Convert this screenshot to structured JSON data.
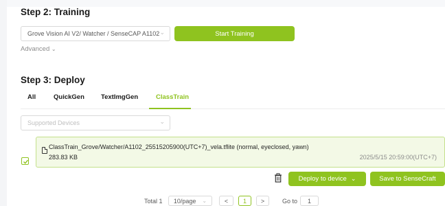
{
  "step2": {
    "title": "Step 2: Training",
    "device_select": "Grove Vision AI V2/ Watcher / SenseCAP A1102",
    "start_button": "Start Training",
    "advanced": "Advanced"
  },
  "step3": {
    "title": "Step 3: Deploy",
    "tabs": [
      {
        "label": "All"
      },
      {
        "label": "QuickGen"
      },
      {
        "label": "TextImgGen"
      },
      {
        "label": "ClassTrain"
      }
    ],
    "active_tab": "ClassTrain",
    "supported_devices_placeholder": "Supported Devices"
  },
  "model_card": {
    "file_name": "ClassTrain_Grove/Watcher/A1102_25515205900(UTC+7)_vela.tflite (normal, eyeclosed, yawn)",
    "file_size": "283.83 KB",
    "date": "2025/5/15 20:59:00(UTC+7)",
    "checked": true
  },
  "actions": {
    "deploy_button": "Deploy to device",
    "save_button": "Save to SenseCraft"
  },
  "pagination": {
    "total": "Total 1",
    "page_size": "10/page",
    "prev": "<",
    "current_page": "1",
    "next": ">",
    "goto_label": "Go to",
    "goto_value": "1"
  },
  "colors": {
    "accent": "#8fc31f",
    "card_background": "#f3f9e6"
  },
  "icons": [
    "chevron-down-icon",
    "file-icon",
    "checkbox-checked-icon",
    "trash-icon"
  ]
}
